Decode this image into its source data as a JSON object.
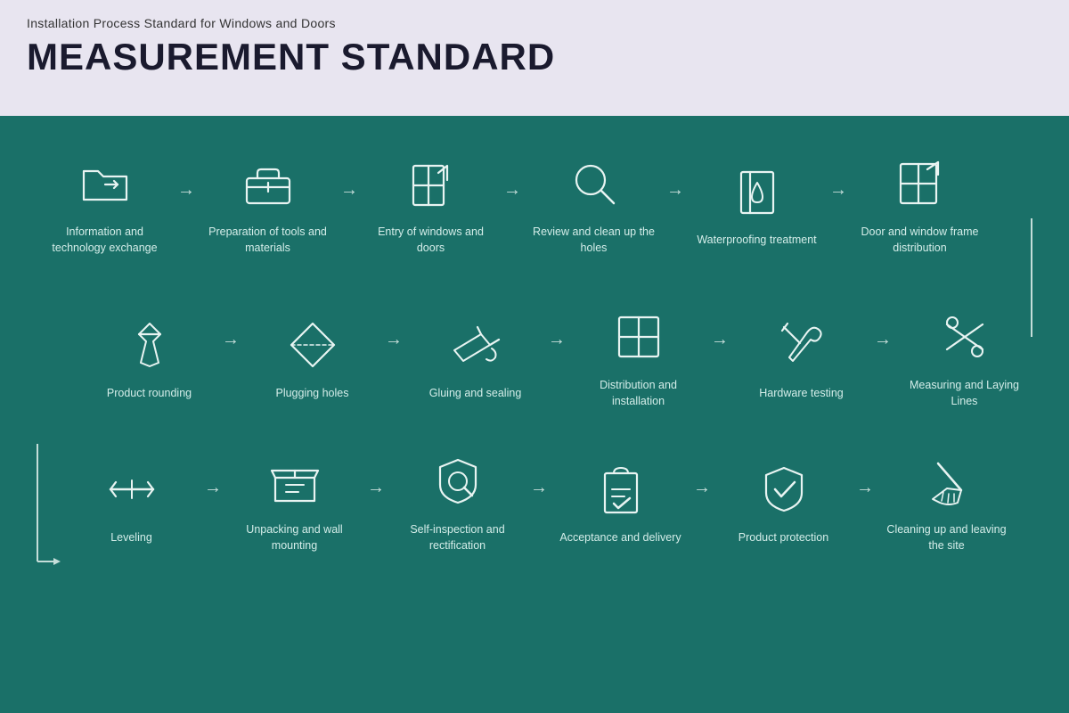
{
  "header": {
    "subtitle": "Installation Process Standard for Windows and Doors",
    "title": "MEASUREMENT STANDARD"
  },
  "colors": {
    "bg_main": "#1a7068",
    "bg_header": "#e8e5f0",
    "icon_stroke": "#e8f4f2",
    "label_color": "#d4ede9",
    "arrow_color": "#c5ddd9"
  },
  "row1": [
    {
      "id": "info-exchange",
      "label": "Information and technology exchange"
    },
    {
      "id": "tools-prep",
      "label": "Preparation of tools and materials"
    },
    {
      "id": "entry-windows",
      "label": "Entry of windows and doors"
    },
    {
      "id": "review-holes",
      "label": "Review and clean up the holes"
    },
    {
      "id": "waterproofing",
      "label": "Waterproofing treatment"
    },
    {
      "id": "frame-dist",
      "label": "Door and window frame distribution"
    }
  ],
  "row2": [
    {
      "id": "measuring",
      "label": "Measuring and Laying Lines"
    },
    {
      "id": "hardware",
      "label": "Hardware testing"
    },
    {
      "id": "distribution",
      "label": "Distribution and installation"
    },
    {
      "id": "gluing",
      "label": "Gluing and sealing"
    },
    {
      "id": "plugging",
      "label": "Plugging holes"
    },
    {
      "id": "rounding",
      "label": "Product rounding"
    }
  ],
  "row3": [
    {
      "id": "leveling",
      "label": "Leveling"
    },
    {
      "id": "unpacking",
      "label": "Unpacking and wall mounting"
    },
    {
      "id": "self-inspect",
      "label": "Self-inspection and rectification"
    },
    {
      "id": "acceptance",
      "label": "Acceptance and delivery"
    },
    {
      "id": "protection",
      "label": "Product protection"
    },
    {
      "id": "cleanup",
      "label": "Cleaning up and leaving the site"
    }
  ]
}
